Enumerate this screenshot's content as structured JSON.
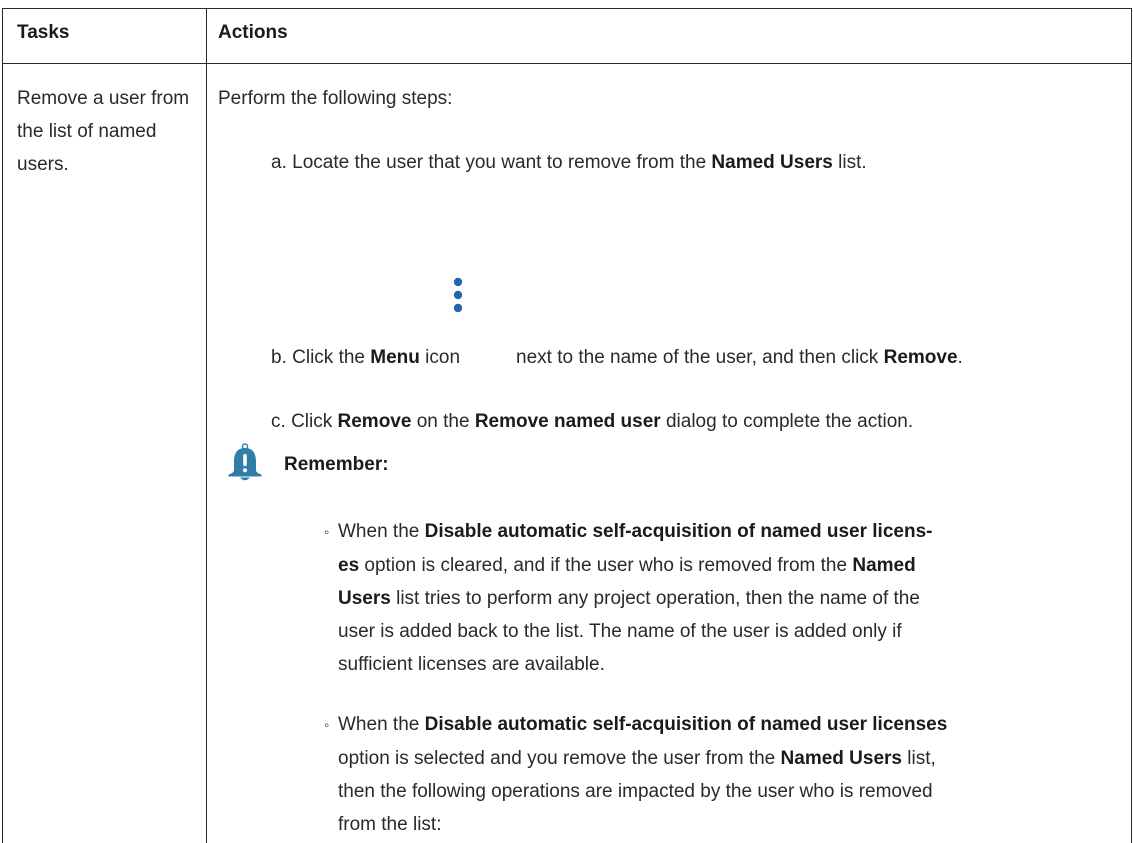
{
  "table": {
    "headers": {
      "tasks": "Tasks",
      "actions": "Actions"
    },
    "task": "Remove a user from the list of named users.",
    "intro": "Perform the following steps:",
    "steps": {
      "a": {
        "marker": "a.",
        "pre": "Locate the user that you want to remove from the ",
        "bold1": "Named Users",
        "post": " list."
      },
      "b": {
        "marker": "b.",
        "pre": "Click the ",
        "bold1": "Menu",
        "mid1": " icon",
        "mid2": "next to the name of the user, and then click ",
        "bold2": "Remove",
        "post": "."
      },
      "c": {
        "marker": "c.",
        "pre": "Click ",
        "bold1": "Remove",
        "mid": " on the ",
        "bold2": "Remove named user",
        "post": " dialog to complete the action."
      }
    },
    "remember": {
      "label": "Remember:",
      "icon": "bell-alert-icon",
      "icon_color": "#2f7ea8",
      "bullets": [
        {
          "marker": "◦",
          "line1_pre": "When the ",
          "line1_bold": "Disable automatic self-acquisition of named user licens-",
          "line2_bold": "es",
          "line2_post": " option is cleared, and if the user who is removed from the ",
          "line2_bold2": "Named",
          "line3_bold": "Users",
          "line3_post": " list tries to perform any project operation, then the name of the",
          "line4": "user is added back to the list. The name of the user is added only if",
          "line5": "sufficient licenses are available."
        },
        {
          "marker": "◦",
          "line1_pre": "When the ",
          "line1_bold": "Disable automatic self-acquisition of named user licenses",
          "line2_pre": "option is selected and you remove the user from the ",
          "line2_bold": "Named Users",
          "line2_post": " list,",
          "line3": "then the following operations are impacted by the user who is removed",
          "line4": "from the list:"
        }
      ]
    },
    "menu_icon": "vertical-dots-menu-icon",
    "menu_icon_color": "#2767a9"
  }
}
